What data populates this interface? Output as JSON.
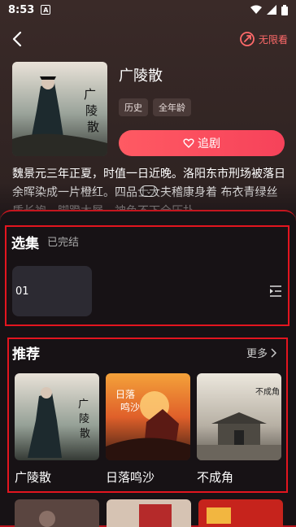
{
  "status_bar": {
    "time": "8:53",
    "badge": "A"
  },
  "header": {
    "no_limit_label": "无限看"
  },
  "drama": {
    "title": "广陵散",
    "tags": [
      "历史",
      "全年龄"
    ],
    "follow_label": "追剧",
    "description": "魏景元三年正夏，时值一日近晚。洛阳东市刑场被落日余晖染成一片橙红。四品士大夫稽康身着 布衣青绿丝质长袍，脚蹬木屐，神色不下全压扑",
    "cover_text": "广陵散"
  },
  "episodes": {
    "title": "选集",
    "status": "已完结",
    "items": [
      "01"
    ]
  },
  "recommend": {
    "title": "推荐",
    "more_label": "更多",
    "items": [
      {
        "name": "广陵散",
        "cover_text": "广陵散"
      },
      {
        "name": "日落鸣沙",
        "cover_text": "日落鸣沙"
      },
      {
        "name": "不成角",
        "cover_text": "不成角"
      }
    ]
  },
  "colors": {
    "accent": "#f6425a",
    "highlight_border": "#e3151f"
  }
}
